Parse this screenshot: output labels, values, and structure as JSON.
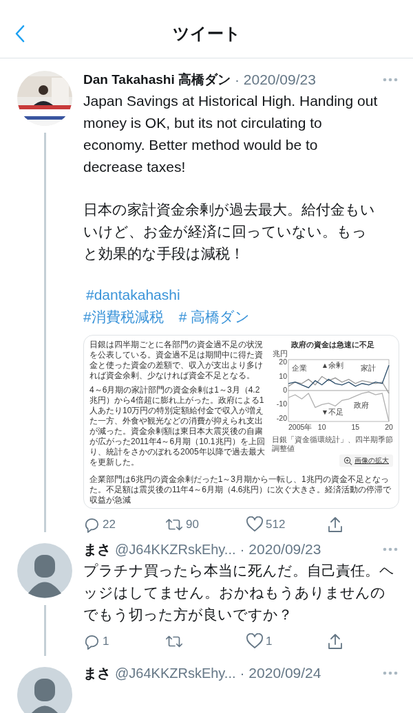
{
  "header": {
    "title": "ツイート"
  },
  "tweet": {
    "name": "Dan Takahashi 高橋ダン",
    "date": "· 2020/09/23",
    "paragraphs": [
      "Japan Savings at Historical High. Handing out money is OK, but its not circulating to economy. Better method would be to decrease taxes!",
      "日本の家計資金余剰が過去最大。給付金もいいけど、お金が経済に回っていない。もっと効果的な手段は減税！"
    ],
    "hashtag_lines": [
      [
        "#dantakahashi"
      ],
      [
        "#消費税減税",
        "# 高橋ダン"
      ]
    ],
    "article": {
      "paragraphs": [
        "日銀は四半期ごとに各部門の資金過不足の状況を公表している。資金過不足は期間中に得た資金と使った資金の差額で、収入が支出より多ければ資金余剰、少なければ資金不足となる。",
        "4～6月期の家計部門の資金余剰は1～3月（4.2兆円）から4倍超に膨れ上がった。政府による1人あたり10万円の特別定額給付金で収入が増えた一方、外食や観光などの消費が抑えられ支出が減った。資金余剰額は東日本大震災後の自粛が広がった2011年4～6月期（10.1兆円）を上回り、統計をさかのぼれる2005年以降で過去最大を更新した。",
        "企業部門は6兆円の資金余剰だった1～3月期から一転し、1兆円の資金不足となった。不足額は震災後の11年4～6月期（4.6兆円）に次ぐ大きさ。経済活動の停滞で収益が急減"
      ],
      "chart_data": {
        "type": "line",
        "title": "政府の資金は急速に不足",
        "ylabel": "兆円",
        "x": [
          2005,
          2006,
          2007,
          2008,
          2009,
          2010,
          2011,
          2012,
          2013,
          2014,
          2015,
          2016,
          2017,
          2018,
          2019,
          2020
        ],
        "xlim": [
          2005,
          2020
        ],
        "ylim": [
          -22,
          22
        ],
        "xticks": [
          {
            "value": 2005,
            "label": "2005年"
          },
          {
            "value": 2010,
            "label": "10"
          },
          {
            "value": 2015,
            "label": "15"
          },
          {
            "value": 2020,
            "label": "20"
          }
        ],
        "yticks": [
          20,
          10,
          0,
          -10,
          -20
        ],
        "series": [
          {
            "name": "企業",
            "color": "#999999",
            "values": [
              3,
              6,
              5,
              8,
              4,
              10,
              7,
              9,
              6,
              8,
              5,
              7,
              6,
              5,
              6,
              -2
            ]
          },
          {
            "name": "家計",
            "color": "#2b4d6a",
            "values": [
              5,
              6,
              4,
              2,
              7,
              4,
              8,
              5,
              4,
              6,
              3,
              5,
              4,
              6,
              5,
              18
            ]
          },
          {
            "name": "政府",
            "color": "#b0b0b0",
            "values": [
              -5,
              -3,
              -6,
              -2,
              -12,
              -10,
              -9,
              -11,
              -7,
              -6,
              -4,
              -2,
              -1,
              -3,
              -2,
              -22
            ]
          }
        ],
        "annotations": [
          "▲余剰",
          "▼不足"
        ]
      },
      "source": "日銀「資金循環統計」、四半期季節調整値",
      "button": "画像の拡大"
    },
    "actions": [
      {
        "kind": "reply",
        "count": "22"
      },
      {
        "kind": "retweet",
        "count": "90"
      },
      {
        "kind": "like",
        "count": "512"
      },
      {
        "kind": "share"
      }
    ]
  },
  "replies": [
    {
      "name": "まさ",
      "handle": "@J64KKZRskEhy...",
      "date": "· 2020/09/23",
      "text": "プラチナ買ったら本当に死んだ。自己責任。ヘッジはしてません。おかねもうありませんのでもう切った方が良いですか？",
      "actions": [
        {
          "kind": "reply",
          "count": "1"
        },
        {
          "kind": "retweet"
        },
        {
          "kind": "like",
          "count": "1"
        },
        {
          "kind": "share"
        }
      ]
    },
    {
      "name": "まさ",
      "handle": "@J64KKZRskEhy...",
      "date": "· 2020/09/24"
    }
  ]
}
